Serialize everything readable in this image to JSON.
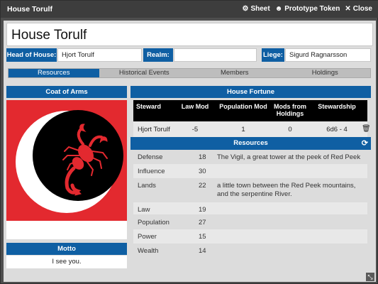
{
  "window": {
    "title": "House Torulf",
    "actions": [
      {
        "icon": "gear-icon",
        "label": "Sheet"
      },
      {
        "icon": "user-circle-icon",
        "label": "Prototype Token"
      },
      {
        "icon": "close-icon",
        "label": "Close"
      }
    ]
  },
  "house": {
    "name": "House Torulf",
    "head_label": "Head of House:",
    "head_value": "Hjort Torulf",
    "realm_label": "Realm:",
    "realm_value": "",
    "liege_label": "Liege:",
    "liege_value": "Sigurd Ragnarsson"
  },
  "tabs": [
    {
      "label": "Resources",
      "active": true
    },
    {
      "label": "Historical Events",
      "active": false
    },
    {
      "label": "Members",
      "active": false
    },
    {
      "label": "Holdings",
      "active": false
    }
  ],
  "coat_of_arms": {
    "heading": "Coat of Arms",
    "colors": {
      "field": "#e3292f",
      "moon": "#ffffff",
      "scorpion": "#e3292f",
      "disc": "#000000"
    }
  },
  "motto": {
    "heading": "Motto",
    "value": "I see you."
  },
  "fortune": {
    "heading": "House Fortune",
    "columns": [
      "Steward",
      "Law Mod",
      "Population Mod",
      "Mods from Holdings",
      "Stewardship"
    ],
    "row": {
      "steward": "Hjort Torulf",
      "law_mod": "-5",
      "population_mod": "1",
      "mods_from_holdings": "0",
      "stewardship": "6d6 - 4"
    }
  },
  "resources": {
    "heading": "Resources",
    "rows": [
      {
        "name": "Defense",
        "value": "18",
        "desc": "The Vigil, a great tower at the peek of Red Peek"
      },
      {
        "name": "Influence",
        "value": "30",
        "desc": ""
      },
      {
        "name": "Lands",
        "value": "22",
        "desc": "a little town between the Red Peek mountains, and the serpentine River."
      },
      {
        "name": "Law",
        "value": "19",
        "desc": ""
      },
      {
        "name": "Population",
        "value": "27",
        "desc": ""
      },
      {
        "name": "Power",
        "value": "15",
        "desc": ""
      },
      {
        "name": "Wealth",
        "value": "14",
        "desc": ""
      }
    ]
  }
}
